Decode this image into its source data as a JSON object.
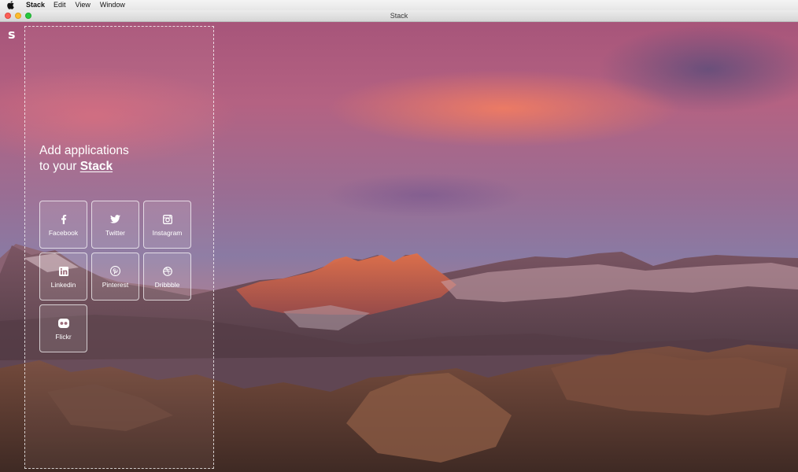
{
  "menubar": {
    "app": "Stack",
    "items": [
      "Edit",
      "View",
      "Window"
    ]
  },
  "window": {
    "title": "Stack"
  },
  "sidebar": {
    "logo": "s",
    "headline_line1": "Add applications",
    "headline_line2_prefix": "to your ",
    "headline_brand": "Stack"
  },
  "apps": [
    {
      "label": "Facebook",
      "icon": "facebook-icon"
    },
    {
      "label": "Twitter",
      "icon": "twitter-icon"
    },
    {
      "label": "Instagram",
      "icon": "instagram-icon"
    },
    {
      "label": "Linkedin",
      "icon": "linkedin-icon"
    },
    {
      "label": "Pinterest",
      "icon": "pinterest-icon"
    },
    {
      "label": "Dribbble",
      "icon": "dribbble-icon"
    },
    {
      "label": "Flickr",
      "icon": "flickr-icon"
    }
  ],
  "colors": {
    "traffic_close": "#fc5f57",
    "traffic_minimize": "#fdbc2e",
    "traffic_maximize": "#28c840"
  }
}
